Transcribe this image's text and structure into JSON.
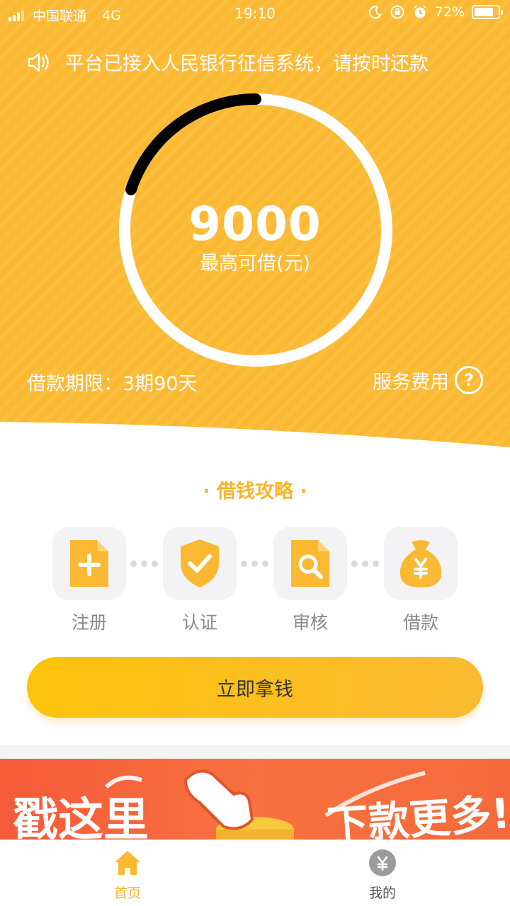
{
  "status_bar": {
    "carrier": "中国联通",
    "network": "4G",
    "time": "19:10",
    "battery": "72%",
    "battery_level": 0.72
  },
  "notice": {
    "text": "平台已接入人民银行征信系统，请按时还款",
    "icon": "speaker-icon"
  },
  "loan": {
    "amount": "9000",
    "amount_label": "最高可借(元)",
    "progress": 0.2,
    "term": "借款期限：3期90天",
    "fee_label": "服务费用",
    "help_icon": "?"
  },
  "guide": {
    "title": "· 借钱攻略 ·",
    "steps": [
      {
        "label": "注册",
        "icon": "add-document-icon"
      },
      {
        "label": "认证",
        "icon": "shield-check-icon"
      },
      {
        "label": "审核",
        "icon": "search-document-icon"
      },
      {
        "label": "借款",
        "icon": "money-bag-icon"
      }
    ]
  },
  "cta": {
    "label": "立即拿钱"
  },
  "banner": {
    "text_left": "戳这里",
    "text_right": "下款更多!"
  },
  "tabs": [
    {
      "label": "首页",
      "icon": "home-icon",
      "active": true
    },
    {
      "label": "我的",
      "icon": "yen-coin-icon",
      "active": false
    }
  ],
  "colors": {
    "primary": "#FBB933",
    "primary_text": "#F7B52C",
    "inactive": "#888888"
  }
}
